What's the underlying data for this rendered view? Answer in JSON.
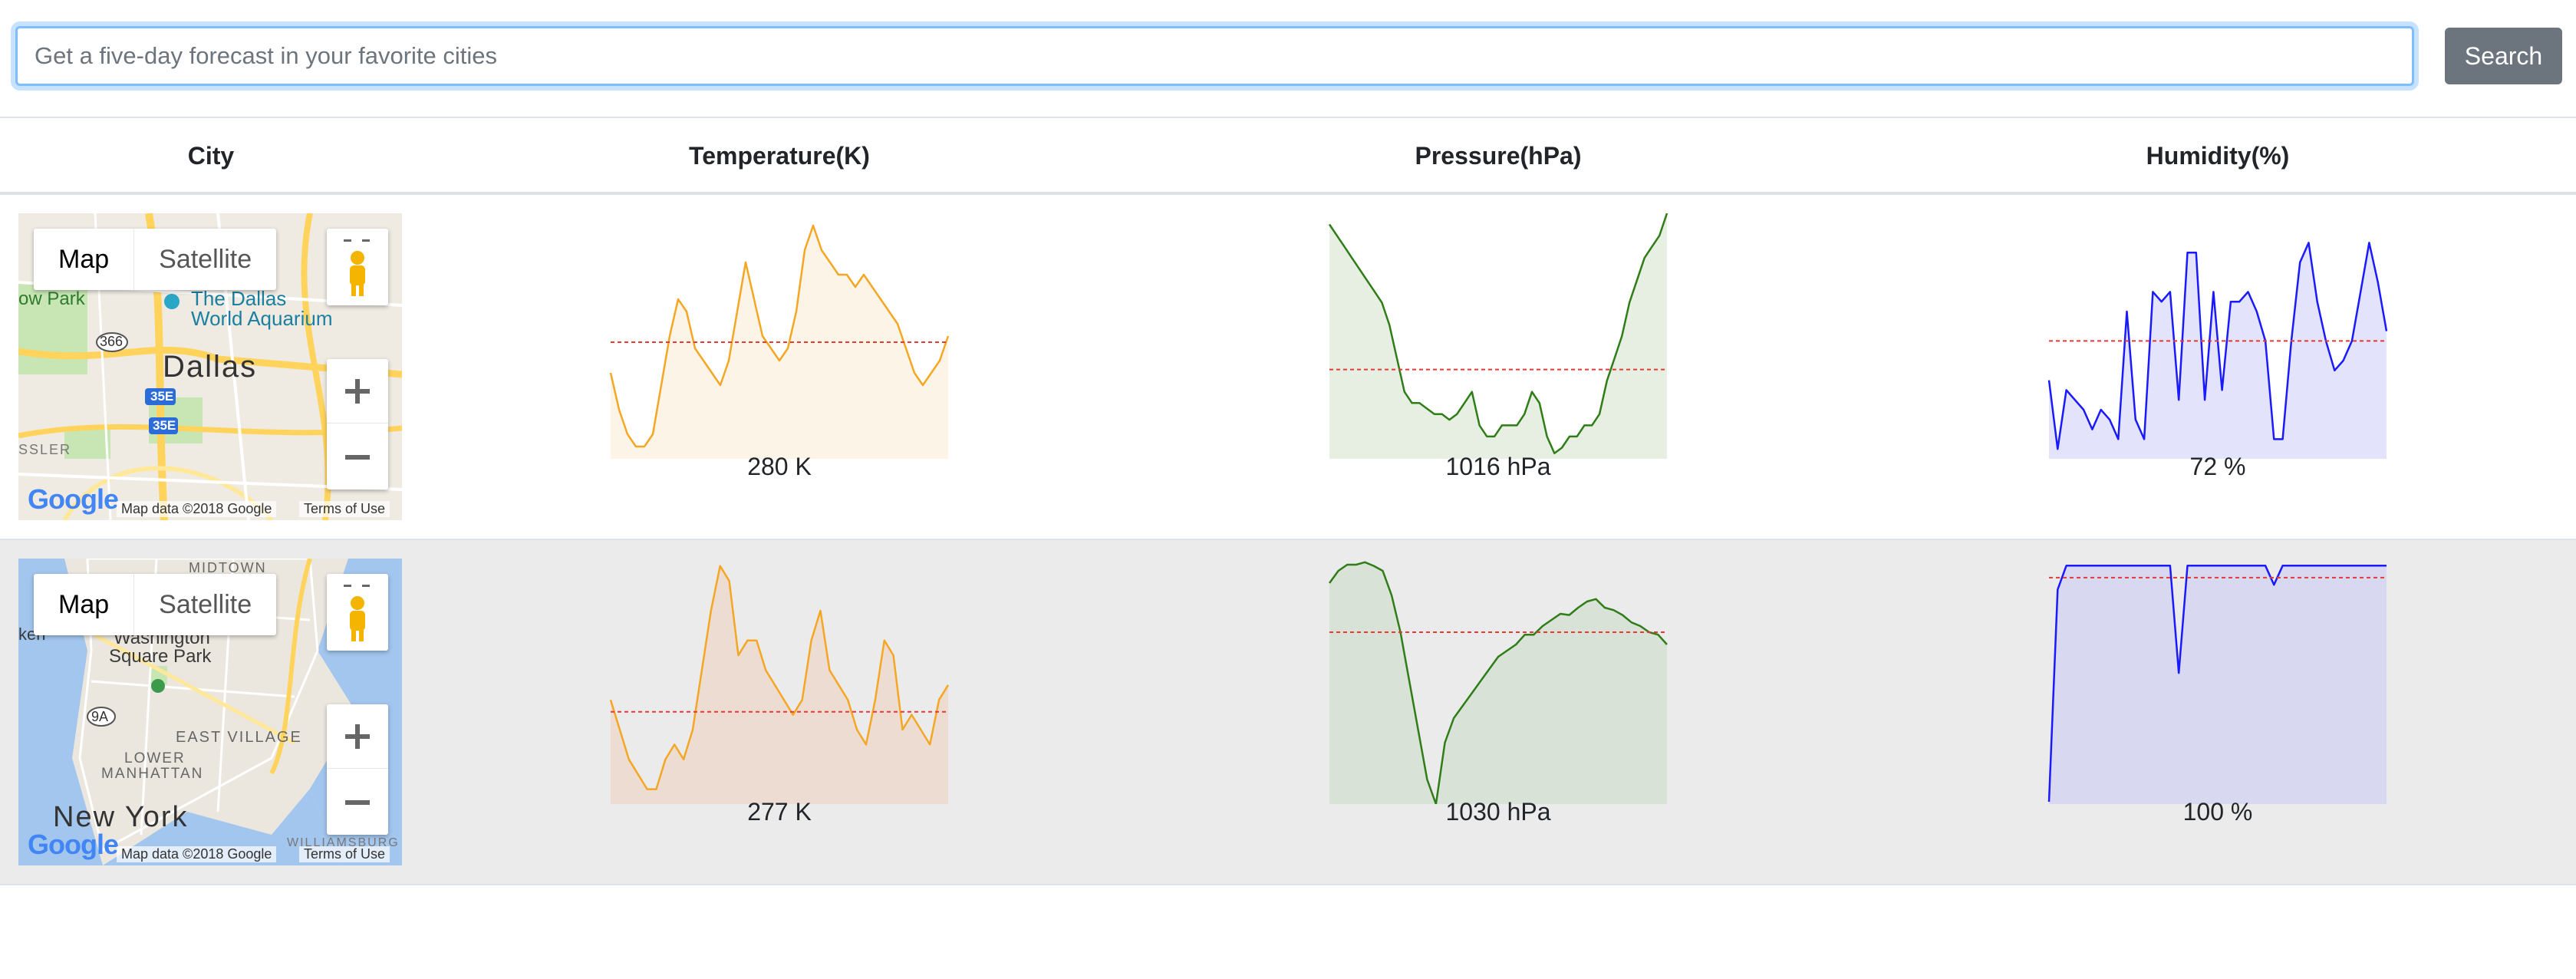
{
  "search": {
    "placeholder": "Get a five-day forecast in your favorite cities",
    "value": "",
    "button_label": "Search"
  },
  "table": {
    "headers": [
      "City",
      "Temperature(K)",
      "Pressure(hPa)",
      "Humidity(%)"
    ]
  },
  "map_common": {
    "map_label": "Map",
    "satellite_label": "Satellite",
    "attribution": "Map data ©2018 Google",
    "terms": "Terms of Use",
    "google": "Google"
  },
  "rows": [
    {
      "map": {
        "city_label": "Dallas",
        "labels": [
          "The Dallas",
          "World Aquarium",
          "ow Park",
          "366",
          "35E",
          "35E",
          "SSLER"
        ]
      },
      "temperature": {
        "value_label": "280 K",
        "color": "#f5a623",
        "fill": "#fdf4e8",
        "values": [
          7,
          4,
          2,
          1,
          1,
          2,
          6,
          10,
          13,
          12,
          9,
          8,
          7,
          6,
          8,
          12,
          16,
          13,
          10,
          9,
          8,
          9,
          12,
          17,
          19,
          17,
          16,
          15,
          15,
          14,
          15,
          14,
          13,
          12,
          11,
          9,
          7,
          6,
          7,
          8,
          10
        ],
        "mean": 9.5,
        "ylim": [
          0,
          20
        ]
      },
      "pressure": {
        "value_label": "1016 hPa",
        "color": "#2e7d17",
        "fill": "#e6efe2",
        "values": [
          21,
          20,
          19,
          18,
          17,
          16,
          15,
          14,
          12,
          9,
          6,
          5,
          5,
          4.5,
          4,
          4,
          3.5,
          4,
          5,
          6,
          3,
          2,
          2,
          3,
          3,
          3,
          4,
          6,
          5,
          2,
          0.5,
          1,
          2,
          2,
          3,
          3,
          4,
          7,
          9,
          11,
          14,
          16,
          18,
          19,
          20,
          22
        ],
        "mean": 8,
        "ylim": [
          0,
          22
        ]
      },
      "humidity": {
        "value_label": "72 %",
        "color": "#1a1aff",
        "fill": "#e3e3fb",
        "values": [
          63,
          56,
          62,
          61,
          60,
          58,
          60,
          59,
          57,
          70,
          59,
          57,
          72,
          71,
          72,
          61,
          76,
          76,
          61,
          72,
          62,
          71,
          71,
          72,
          70,
          67,
          57,
          57,
          67,
          75,
          77,
          71,
          67,
          64,
          65,
          67,
          72,
          77,
          73,
          68
        ],
        "mean": 67,
        "ylim": [
          55,
          80
        ]
      }
    },
    {
      "map": {
        "city_label": "New York",
        "labels": [
          "MIDTOWN",
          "Washington",
          "Square Park",
          "9A",
          "EAST VILLAGE",
          "LOWER",
          "MANHATTAN",
          "WILLIAMSBURG",
          "ken"
        ]
      },
      "temperature": {
        "value_label": "277 K",
        "color": "#f5a623",
        "fill": "#ecdcd2",
        "values": [
          7,
          5,
          3,
          2,
          1,
          1,
          3,
          4,
          3,
          5,
          9,
          13,
          16,
          15,
          10,
          11,
          11,
          9,
          8,
          7,
          6,
          7,
          11,
          13,
          9,
          8,
          7,
          5,
          4,
          7,
          11,
          10,
          5,
          6,
          5,
          4,
          7,
          8
        ],
        "mean": 6.2,
        "ylim": [
          0,
          16.5
        ]
      },
      "pressure": {
        "value_label": "1030 hPa",
        "color": "#2e7d17",
        "fill": "#d9e2d7",
        "values": [
          18,
          19,
          19.5,
          19.5,
          19.7,
          19.4,
          19,
          17,
          14,
          10,
          6,
          2,
          0,
          5,
          7,
          8,
          9,
          10,
          11,
          12,
          12.5,
          13,
          13.8,
          13.8,
          14.5,
          15,
          15.5,
          15.4,
          16,
          16.5,
          16.7,
          16,
          15.8,
          15.4,
          14.8,
          14.5,
          14,
          13.8,
          13
        ],
        "mean": 14,
        "ylim": [
          0,
          20
        ]
      },
      "humidity": {
        "value_label": "100 %",
        "color": "#1a1aff",
        "fill": "#d8d8f0",
        "values": [
          1,
          90,
          100,
          100,
          100,
          100,
          100,
          100,
          100,
          100,
          100,
          100,
          100,
          100,
          100,
          55,
          100,
          100,
          100,
          100,
          100,
          100,
          100,
          100,
          100,
          100,
          92,
          100,
          100,
          100,
          100,
          100,
          100,
          100,
          100,
          100,
          100,
          100,
          100,
          100
        ],
        "mean": 95,
        "ylim": [
          0,
          103
        ]
      }
    }
  ]
}
